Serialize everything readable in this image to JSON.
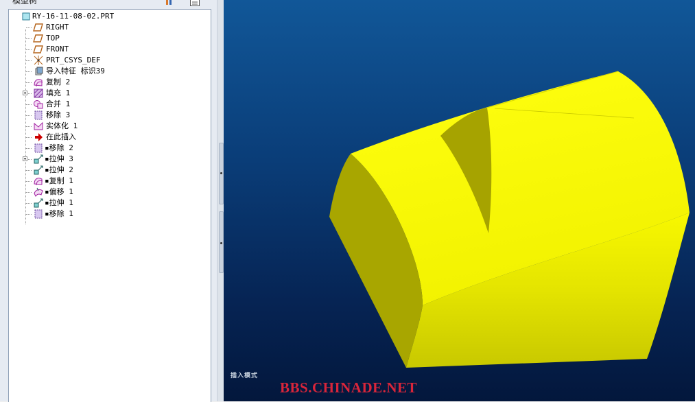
{
  "panel": {
    "title": "模型树"
  },
  "tree": {
    "root": "RY-16-11-08-02.PRT",
    "items": [
      {
        "label": "RIGHT",
        "icon": "datum-plane-icon",
        "expandable": false,
        "bullet": false
      },
      {
        "label": "TOP",
        "icon": "datum-plane-icon",
        "expandable": false,
        "bullet": false
      },
      {
        "label": "FRONT",
        "icon": "datum-plane-icon",
        "expandable": false,
        "bullet": false
      },
      {
        "label": "PRT_CSYS_DEF",
        "icon": "csys-icon",
        "expandable": false,
        "bullet": false
      },
      {
        "label": "导入特征 标识39",
        "icon": "import-feature-icon",
        "expandable": false,
        "bullet": false
      },
      {
        "label": "复制 2",
        "icon": "copy-icon",
        "expandable": false,
        "bullet": false
      },
      {
        "label": "填充 1",
        "icon": "fill-icon",
        "expandable": true,
        "bullet": false
      },
      {
        "label": "合并 1",
        "icon": "merge-icon",
        "expandable": false,
        "bullet": false
      },
      {
        "label": "移除 3",
        "icon": "remove-icon",
        "expandable": false,
        "bullet": false
      },
      {
        "label": "实体化 1",
        "icon": "solidify-icon",
        "expandable": false,
        "bullet": false
      },
      {
        "label": "在此插入",
        "icon": "insert-here-arrow-icon",
        "expandable": false,
        "bullet": false
      },
      {
        "label": "移除 2",
        "icon": "remove-icon",
        "expandable": false,
        "bullet": true
      },
      {
        "label": "拉伸 3",
        "icon": "extrude-icon",
        "expandable": true,
        "bullet": true
      },
      {
        "label": "拉伸 2",
        "icon": "extrude-icon",
        "expandable": false,
        "bullet": true
      },
      {
        "label": "复制 1",
        "icon": "copy-icon",
        "expandable": false,
        "bullet": true
      },
      {
        "label": "偏移 1",
        "icon": "offset-icon",
        "expandable": false,
        "bullet": true
      },
      {
        "label": "拉伸 1",
        "icon": "extrude-icon",
        "expandable": false,
        "bullet": true
      },
      {
        "label": "移除 1",
        "icon": "remove-icon",
        "expandable": false,
        "bullet": true
      }
    ]
  },
  "viewport": {
    "mode_text": "插入模式",
    "watermark": "BBS.CHINADE.NET",
    "model_color": "#ffff00",
    "background_top": "#115798",
    "background_bottom": "#03173c"
  }
}
